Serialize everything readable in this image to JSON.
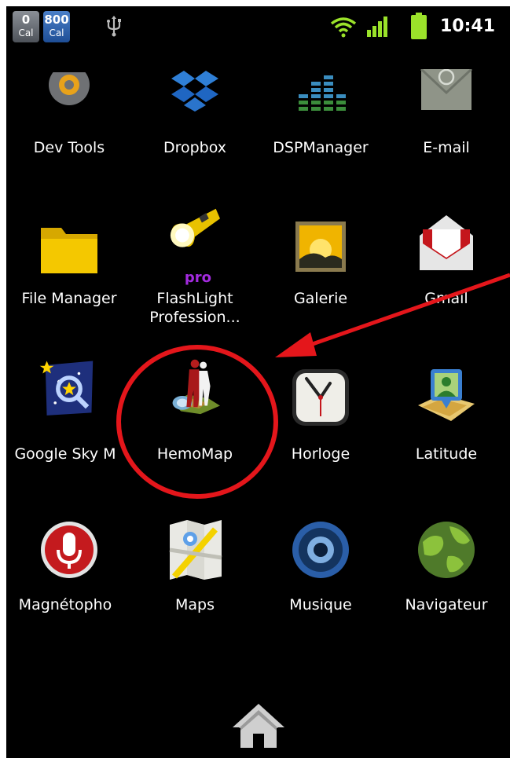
{
  "status_bar": {
    "badge1_num": "0",
    "badge1_unit": "Cal",
    "badge2_num": "800",
    "badge2_unit": "Cal",
    "time": "10:41"
  },
  "apps": {
    "dev_tools": "Dev Tools",
    "dropbox": "Dropbox",
    "dspmanager": "DSPManager",
    "email": "E-mail",
    "file_manager": "File Manager",
    "flashlight_line1": "FlashLight",
    "flashlight_line2": "Profession...",
    "flashlight_badge": "pro",
    "galerie": "Galerie",
    "gmail": "Gmail",
    "google_sky": "Google Sky M",
    "hemomap": "HemoMap",
    "horloge": "Horloge",
    "latitude": "Latitude",
    "magnetophone": "Magnétopho",
    "maps": "Maps",
    "musique": "Musique",
    "navigateur": "Navigateur"
  },
  "email_icon_glyph": "@",
  "icons": [
    "usb-icon",
    "wifi-icon",
    "signal-icon",
    "battery-icon",
    "home-icon"
  ],
  "colors": {
    "background": "#000000",
    "annotation": "#e4161b",
    "text": "#ffffff"
  }
}
